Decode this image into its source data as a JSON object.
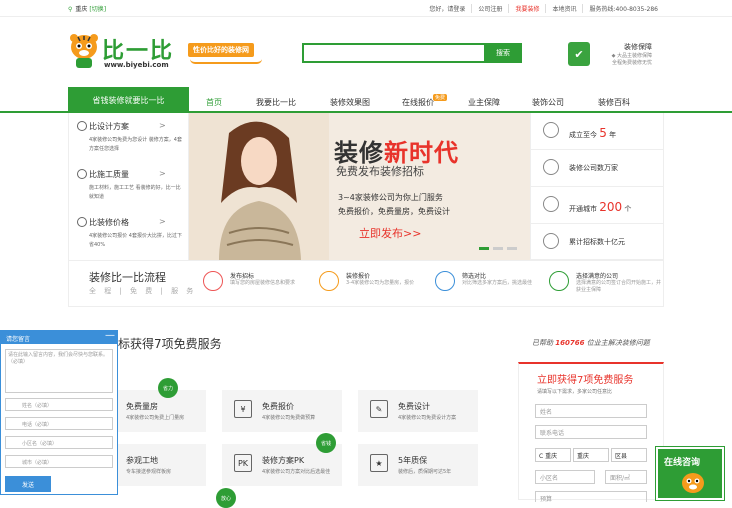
{
  "topbar": {
    "city": "重庆",
    "switch": "[切换]",
    "links": [
      "您好，请登录",
      "公司注册",
      "我要装修",
      "本地资讯",
      "服务热线:400-8035-286"
    ]
  },
  "logo": {
    "text": "比一比",
    "url": "www.biyebi.com",
    "slogan": "性价比好的装修网"
  },
  "search": {
    "placeholder": "",
    "button": "搜索"
  },
  "guarantee": {
    "title": "装修保障",
    "line1": "◆ 大品主装修保障",
    "line2": "全程免费装修无忧"
  },
  "nav": {
    "cta": "省钱装修就要比一比",
    "items": [
      "首页",
      "我要比一比",
      "装修效果图",
      "在线报价",
      "业主保障",
      "装饰公司",
      "装修百科"
    ],
    "hot": "免费"
  },
  "left_menu": [
    {
      "title": "比设计方案",
      "arrow": ">",
      "sub": "4家装修公司免费为您设计 装修方案，4套方案任您选择"
    },
    {
      "title": "比施工质量",
      "arrow": ">",
      "sub": "施工材料，施工工艺 看装修的好，比一比就知道"
    },
    {
      "title": "比装修价格",
      "arrow": ">",
      "sub": "4家装修公司报价 4套报价大比拼，比过下省40%"
    }
  ],
  "banner": {
    "title_a": "装修",
    "title_b": "新时代",
    "sub": "免费发布装修招标",
    "line1": "3~4家装修公司为你上门服务",
    "line2": "免费报价，免费量房，免费设计",
    "cta": "立即发布>>"
  },
  "stats": [
    {
      "prefix": "成立至今",
      "num": "5",
      "suffix": "年"
    },
    {
      "prefix": "装修公司数万家",
      "num": "",
      "suffix": ""
    },
    {
      "prefix": "开通城市",
      "num": "200",
      "suffix": "个"
    },
    {
      "prefix": "累计招标数十亿元",
      "num": "",
      "suffix": ""
    }
  ],
  "process": {
    "title": "装修比一比流程",
    "sub": "全 程 | 免 费 | 服 务",
    "steps": [
      {
        "t": "发布招标",
        "s": "填写您的房屋装修信息和要求"
      },
      {
        "t": "装修报价",
        "s": "3-4家装修公司为您量房，报价"
      },
      {
        "t": "筛选对比",
        "s": "对比筛选多家方案后，挑选最佳"
      },
      {
        "t": "选择满意的公司",
        "s": "选择满意的公司签订合同开始施工，并获业主保障"
      }
    ]
  },
  "services": {
    "title": "标获得7项免费服务",
    "helped_pre": "已帮助",
    "helped_num": "160766",
    "helped_post": "位业主解决装修问题",
    "cards": [
      {
        "icon": "尺",
        "t": "免费量房",
        "s": "4家装修公司免费上门量房",
        "badge": "省力"
      },
      {
        "icon": "¥",
        "t": "免费报价",
        "s": "4家装修公司免费做预算",
        "badge": ""
      },
      {
        "icon": "✎",
        "t": "免费设计",
        "s": "4家装修公司免费设计方案",
        "badge": ""
      },
      {
        "icon": "⌂",
        "t": "参观工地",
        "s": "专车接送参观样板房",
        "badge": ""
      },
      {
        "icon": "PK",
        "t": "装修方案PK",
        "s": "4家装修公司方案对比后选最佳",
        "badge": "省钱"
      },
      {
        "icon": "★",
        "t": "5年质保",
        "s": "装修后，质保期可达5年",
        "badge": ""
      }
    ],
    "badge3": "放心"
  },
  "form": {
    "title": "立即获得7项免费服务",
    "sub": "请填写以下需求，多家公司任意比",
    "name": "姓名",
    "phone": "联系电话",
    "sel1": "C 重庆",
    "sel2": "重庆",
    "sel3": "区县",
    "community": "小区名",
    "area": "面积/㎡",
    "budget": "预算"
  },
  "float_msg": {
    "header": "请您留言",
    "text": "请在此输入留言内容，我们会尽快与您联系。（必填）",
    "fields": [
      "姓名（必填）",
      "电话（必填）",
      "小区名（必填）",
      "城市（必填）"
    ],
    "send": "发送",
    "min": "—"
  },
  "float_consult": {
    "label": "在线咨询"
  }
}
